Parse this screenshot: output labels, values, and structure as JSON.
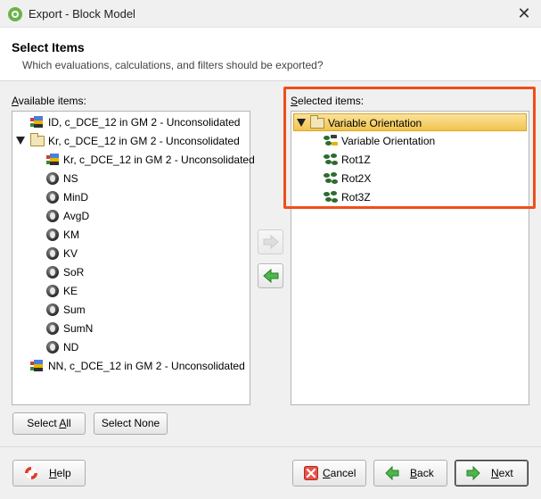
{
  "window": {
    "title": "Export - Block Model",
    "close_glyph": "✕"
  },
  "header": {
    "title": "Select Items",
    "subtitle": "Which evaluations, calculations, and filters should be exported?"
  },
  "available": {
    "label_access": "A",
    "label_rest": "vailable items:",
    "items": [
      {
        "label": "ID, c_DCE_12 in GM 2 - Unconsolidated",
        "icon": "evaluation-icon"
      },
      {
        "label": "Kr, c_DCE_12 in GM 2 - Unconsolidated",
        "icon": "folder-icon",
        "expanded": true
      },
      {
        "label": "Kr, c_DCE_12 in GM 2 - Unconsolidated",
        "icon": "evaluation-icon"
      },
      {
        "label": "NS",
        "icon": "calculation-icon"
      },
      {
        "label": "MinD",
        "icon": "calculation-icon"
      },
      {
        "label": "AvgD",
        "icon": "calculation-icon"
      },
      {
        "label": "KM",
        "icon": "calculation-icon"
      },
      {
        "label": "KV",
        "icon": "calculation-icon"
      },
      {
        "label": "SoR",
        "icon": "calculation-icon"
      },
      {
        "label": "KE",
        "icon": "calculation-icon"
      },
      {
        "label": "Sum",
        "icon": "calculation-icon"
      },
      {
        "label": "SumN",
        "icon": "calculation-icon"
      },
      {
        "label": "ND",
        "icon": "calculation-icon"
      },
      {
        "label": "NN, c_DCE_12 in GM 2 - Unconsolidated",
        "icon": "evaluation-icon"
      }
    ]
  },
  "selected": {
    "label_access": "S",
    "label_rest": "elected items:",
    "items": [
      {
        "label": "Variable Orientation",
        "icon": "folder-icon",
        "expanded": true,
        "selected": true
      },
      {
        "label": "Variable Orientation",
        "icon": "variable-orientation-icon"
      },
      {
        "label": "Rot1Z",
        "icon": "variable-orientation-icon"
      },
      {
        "label": "Rot2X",
        "icon": "variable-orientation-icon"
      },
      {
        "label": "Rot3Z",
        "icon": "variable-orientation-icon"
      }
    ]
  },
  "buttons": {
    "select_all_pre": "Select ",
    "select_all_access": "A",
    "select_all_post": "ll",
    "select_none": "Select None",
    "help_access": "H",
    "help_rest": "elp",
    "cancel_access": "C",
    "cancel_rest": "ancel",
    "back_access": "B",
    "back_rest": "ack",
    "next_access": "N",
    "next_rest": "ext"
  },
  "colors": {
    "highlight_border": "#f04e1a",
    "selection_fill": "#f2c44f",
    "arrow_green": "#3aa03a"
  }
}
